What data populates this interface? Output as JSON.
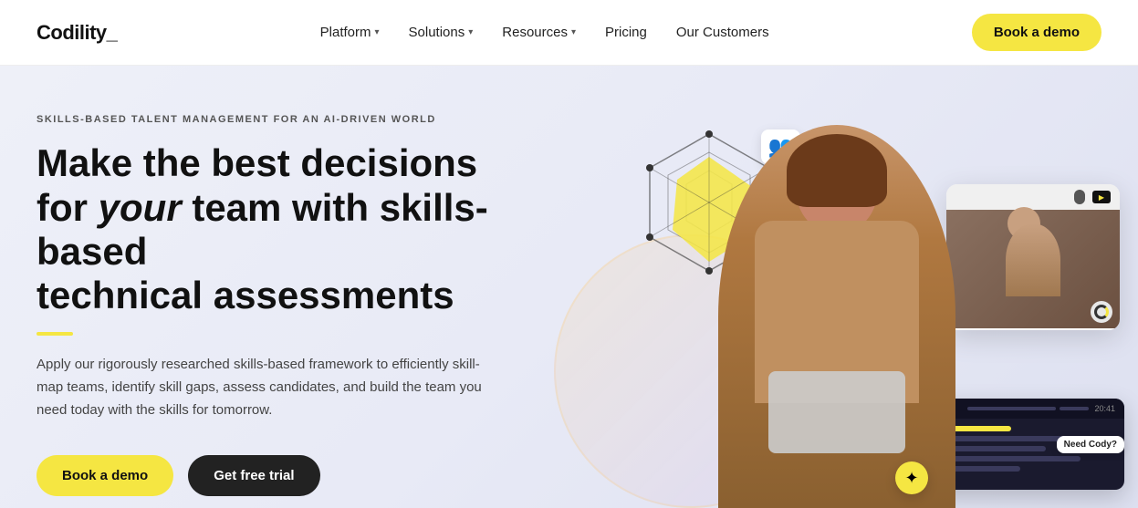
{
  "brand": {
    "logo": "Codility_",
    "logo_symbol": "_"
  },
  "nav": {
    "links": [
      {
        "label": "Platform",
        "has_dropdown": true
      },
      {
        "label": "Solutions",
        "has_dropdown": true
      },
      {
        "label": "Resources",
        "has_dropdown": true
      },
      {
        "label": "Pricing",
        "has_dropdown": false
      },
      {
        "label": "Our Customers",
        "has_dropdown": false
      }
    ],
    "cta_label": "Book a demo"
  },
  "hero": {
    "eyebrow": "SKILLS-BASED TALENT MANAGEMENT FOR AN AI-DRIVEN WORLD",
    "title_part1": "Make the best decisions",
    "title_part2": "for ",
    "title_italic": "your",
    "title_part3": " team with skills-based",
    "title_part4": "technical assessments",
    "description": "Apply our rigorously researched skills-based framework to efficiently skill-map teams, identify skill gaps, assess candidates, and build the team you need today with the skills for tomorrow.",
    "btn_demo": "Book a demo",
    "btn_trial": "Get free trial"
  },
  "widgets": {
    "cody_label": "Need Cody?",
    "code_header_label": "C_",
    "video_time": "20:41"
  },
  "colors": {
    "accent_yellow": "#f5e642",
    "dark": "#111111",
    "bg": "#eef0f8"
  }
}
